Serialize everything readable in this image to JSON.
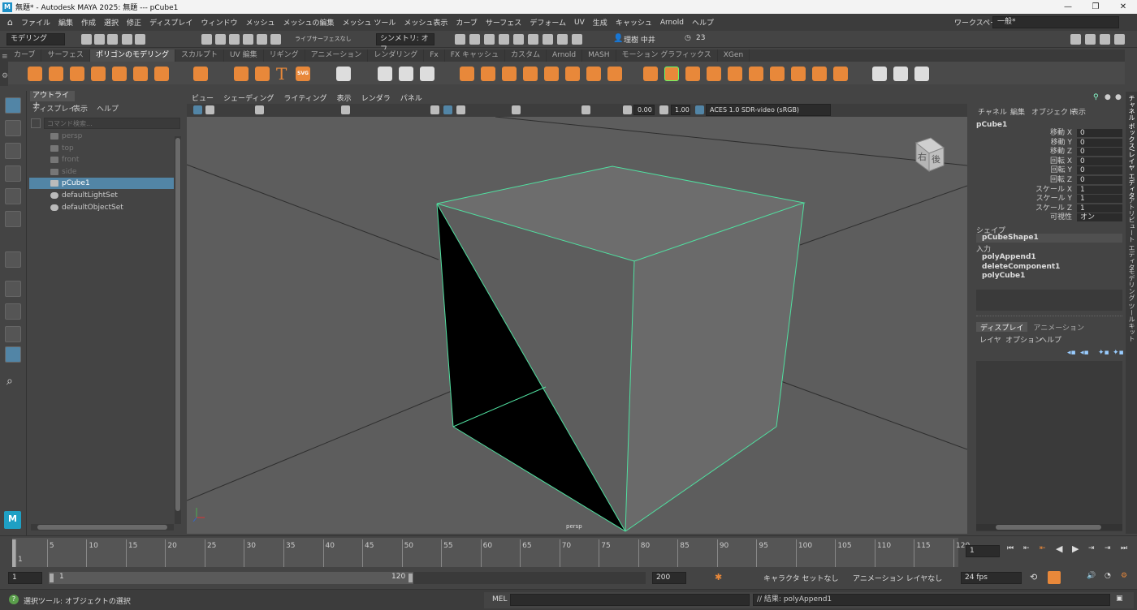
{
  "titlebar": {
    "logo": "M",
    "title": "無題* - Autodesk MAYA 2025: 無題   ---   pCube1"
  },
  "menubar": {
    "items": [
      "ファイル",
      "編集",
      "作成",
      "選択",
      "修正",
      "ディスプレイ",
      "ウィンドウ",
      "メッシュ",
      "メッシュの編集",
      "メッシュ ツール",
      "メッシュ表示",
      "カーブ",
      "サーフェス",
      "デフォーム",
      "UV",
      "生成",
      "キャッシュ",
      "Arnold",
      "ヘルプ"
    ],
    "workspace_label": "ワークスペース:",
    "workspace_value": "一般*"
  },
  "statusline": {
    "mode": "モデリング",
    "live": "ライブ",
    "live_surface": "サーフェスなし",
    "symmetry": "シンメトリ: オフ",
    "user": "理樹 中井",
    "credits": "23"
  },
  "shelf": {
    "tabs": [
      "カーブ",
      "サーフェス",
      "ポリゴンのモデリング",
      "スカルプト",
      "UV 編集",
      "リギング",
      "アニメーション",
      "レンダリング",
      "Fx",
      "FX キャッシュ",
      "カスタム",
      "Arnold",
      "MASH",
      "モーション グラフィックス",
      "XGen"
    ],
    "active_tab": 2,
    "text_icon": "T",
    "svg_icon": "SVG"
  },
  "outliner": {
    "tab": "アウトライナ",
    "menu": [
      "ディスプレイ",
      "表示",
      "ヘルプ"
    ],
    "search_placeholder": "コマンド検索...",
    "items": [
      {
        "label": "persp",
        "dim": true
      },
      {
        "label": "top",
        "dim": true
      },
      {
        "label": "front",
        "dim": true
      },
      {
        "label": "side",
        "dim": true
      },
      {
        "label": "pCube1",
        "selected": true
      },
      {
        "label": "defaultLightSet"
      },
      {
        "label": "defaultObjectSet"
      }
    ]
  },
  "viewport": {
    "menu": [
      "ビュー",
      "シェーディング",
      "ライティング",
      "表示",
      "レンダラ",
      "パネル"
    ],
    "exposure": "0.00",
    "gamma": "1.00",
    "colorspace": "ACES 1.0 SDR-video (sRGB)",
    "camera_label": "persp",
    "viewcube_front": "右",
    "viewcube_side": "後"
  },
  "channelbox": {
    "menu": [
      "チャネル",
      "編集",
      "オブジェクト",
      "表示"
    ],
    "object": "pCube1",
    "attrs": [
      {
        "label": "移動 X",
        "value": "0"
      },
      {
        "label": "移動 Y",
        "value": "0"
      },
      {
        "label": "移動 Z",
        "value": "0"
      },
      {
        "label": "回転 X",
        "value": "0"
      },
      {
        "label": "回転 Y",
        "value": "0"
      },
      {
        "label": "回転 Z",
        "value": "0"
      },
      {
        "label": "スケール X",
        "value": "1"
      },
      {
        "label": "スケール Y",
        "value": "1"
      },
      {
        "label": "スケール Z",
        "value": "1"
      },
      {
        "label": "可視性",
        "value": "オン"
      }
    ],
    "shapes_label": "シェイプ",
    "shape": "pCubeShape1",
    "inputs_label": "入力",
    "inputs": [
      "polyAppend1",
      "deleteComponent1",
      "polyCube1"
    ]
  },
  "layers": {
    "tabs": [
      "ディスプレイ",
      "アニメーション"
    ],
    "menu": [
      "レイヤ",
      "オプション",
      "ヘルプ"
    ]
  },
  "sidebar_tabs": [
    "チャネル ボックス/レイヤ エディタ",
    "アトリビュート エディタ",
    "モデリング ツールキット"
  ],
  "timeline": {
    "ticks": [
      "1",
      "5",
      "10",
      "15",
      "20",
      "25",
      "30",
      "35",
      "40",
      "45",
      "50",
      "55",
      "60",
      "65",
      "70",
      "75",
      "80",
      "85",
      "90",
      "95",
      "100",
      "105",
      "110",
      "115",
      "120"
    ],
    "current_frame": "1"
  },
  "range": {
    "start": "1",
    "inner_start": "1",
    "inner_end": "120",
    "end": "200",
    "character_set": "キャラクタ セットなし",
    "anim_layer": "アニメーション レイヤなし",
    "fps": "24 fps"
  },
  "commandline": {
    "help": "選択ツール: オブジェクトの選択",
    "lang": "MEL",
    "result": "// 結果: polyAppend1"
  }
}
